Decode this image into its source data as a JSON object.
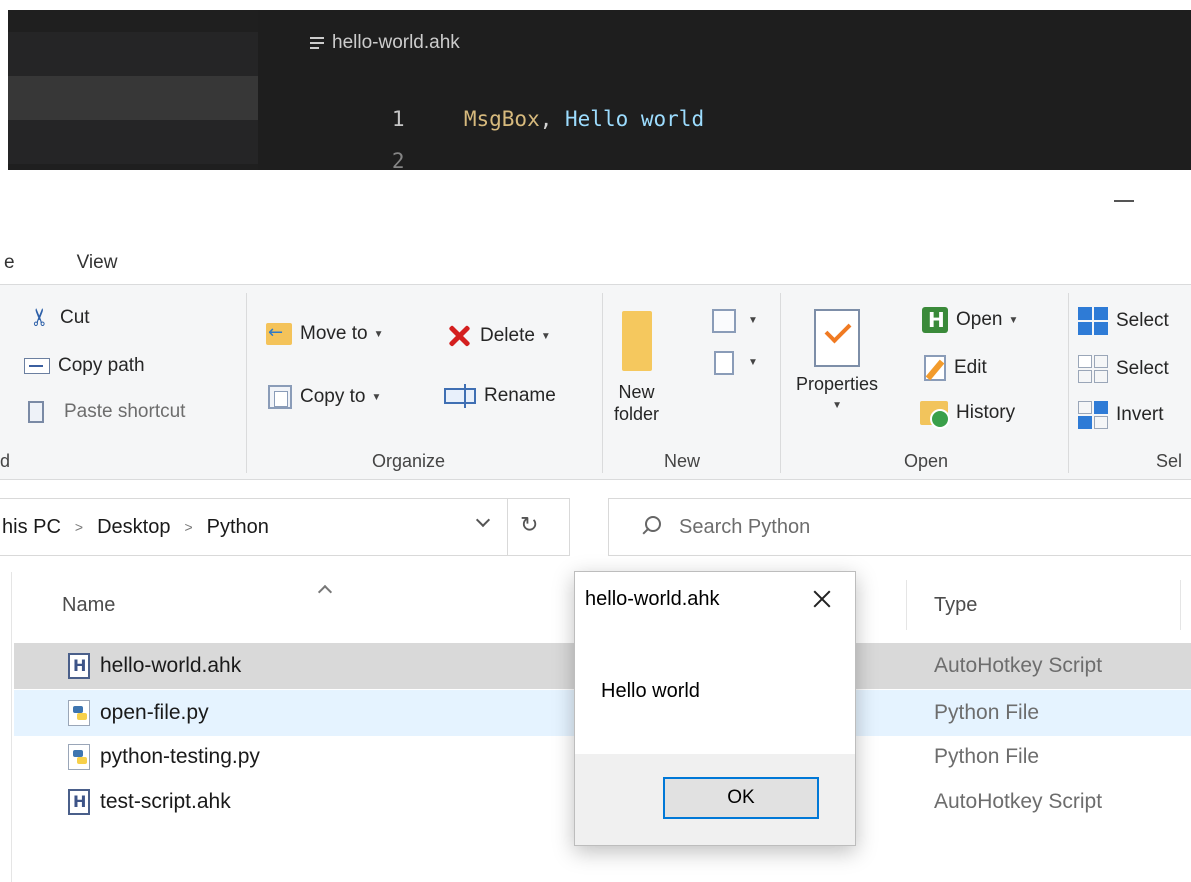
{
  "editor": {
    "breadcrumb_file": "hello-world.ahk",
    "lines": [
      {
        "number": "1",
        "command": "MsgBox",
        "punct": ",",
        "argument": " Hello world"
      },
      {
        "number": "2"
      }
    ],
    "colors": {
      "background": "#1e1e1e",
      "command": "#d7ba7d",
      "string": "#9cdcfe"
    }
  },
  "explorer": {
    "tabs": [
      "e",
      "View"
    ],
    "ribbon": {
      "clipboard": {
        "cut": "Cut",
        "copy_path": "Copy path",
        "paste_shortcut": "Paste shortcut",
        "group_label_fragment": "d"
      },
      "organize": {
        "move_to": "Move to",
        "copy_to": "Copy to",
        "delete": "Delete",
        "rename": "Rename",
        "group_label": "Organize"
      },
      "new": {
        "new_folder_line1": "New",
        "new_folder_line2": "folder",
        "group_label": "New"
      },
      "open": {
        "properties": "Properties",
        "open": "Open",
        "edit": "Edit",
        "history": "History",
        "group_label": "Open"
      },
      "select": {
        "select_all": "Select",
        "select_none": "Select",
        "invert": "Invert",
        "group_label": "Sel"
      }
    },
    "address": {
      "crumbs": [
        "his PC",
        "Desktop",
        "Python"
      ]
    },
    "search": {
      "placeholder": "Search Python"
    },
    "columns": {
      "name": "Name",
      "type": "Type"
    },
    "files": [
      {
        "name": "hello-world.ahk",
        "type": "AutoHotkey Script",
        "icon": "ahk-file-icon",
        "state": "selected"
      },
      {
        "name": "open-file.py",
        "type": "Python File",
        "icon": "python-file-icon",
        "state": "hover"
      },
      {
        "name": "python-testing.py",
        "type": "Python File",
        "icon": "python-file-icon",
        "state": ""
      },
      {
        "name": "test-script.ahk",
        "type": "AutoHotkey Script",
        "icon": "ahk-file-icon",
        "state": ""
      }
    ]
  },
  "msgbox": {
    "title": "hello-world.ahk",
    "message": "Hello world",
    "ok_label": "OK",
    "accent_color": "#0078d7"
  }
}
